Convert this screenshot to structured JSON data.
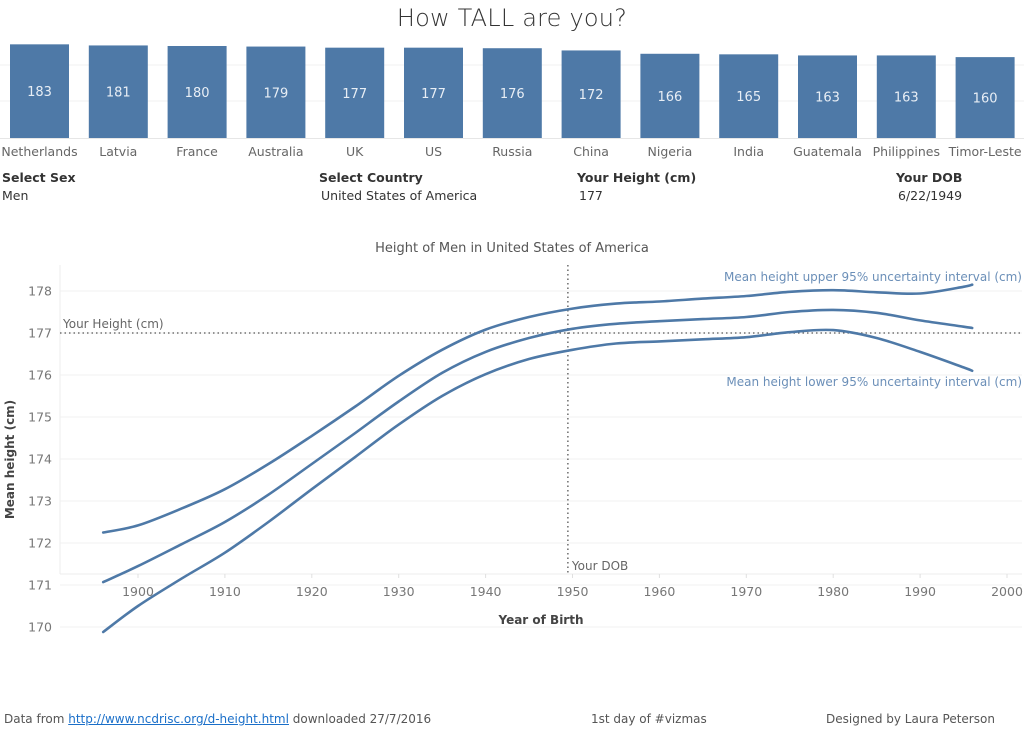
{
  "page": {
    "title": "How TALL are you?"
  },
  "filters": {
    "sex": {
      "label": "Select Sex",
      "value": "Men"
    },
    "country": {
      "label": "Select Country",
      "value": "United States of America"
    },
    "height": {
      "label": "Your Height (cm)",
      "value": "177"
    },
    "dob": {
      "label": "Your DOB",
      "value": "6/22/1949"
    }
  },
  "footer": {
    "prefix": "Data from ",
    "link_text": "http://www.ncdrisc.org/d-height.html",
    "suffix": " downloaded 27/7/2016",
    "center": "1st day of #vizmas",
    "right": "Designed by Laura Peterson"
  },
  "colors": {
    "bar": "#4e79a7",
    "line": "#4e79a7",
    "label_blue": "#6b8fb8",
    "grid": "#f0f0f0",
    "ref_line": "#555555"
  },
  "chart_data": [
    {
      "type": "bar",
      "title": "",
      "categories": [
        "Netherlands",
        "Latvia",
        "France",
        "Australia",
        "UK",
        "US",
        "Russia",
        "China",
        "Nigeria",
        "India",
        "Guatemala",
        "Philippines",
        "Timor-Leste"
      ],
      "values": [
        183,
        181,
        180,
        179,
        177,
        177,
        176,
        172,
        166,
        165,
        163,
        163,
        160
      ],
      "data_labels": [
        "183",
        "181",
        "180",
        "179",
        "177",
        "177",
        "176",
        "172",
        "166",
        "165",
        "163",
        "163",
        "160"
      ],
      "xlabel": "",
      "ylabel": "",
      "ylim": [
        0,
        185
      ],
      "grid": true
    },
    {
      "type": "line",
      "title": "Height of Men in United States of America",
      "xlabel": "Year of Birth",
      "ylabel": "Mean height (cm)",
      "xlim": [
        1891,
        2001
      ],
      "ylim": [
        169.45,
        178.55
      ],
      "xticks": [
        1900,
        1910,
        1920,
        1930,
        1940,
        1950,
        1960,
        1970,
        1980,
        1990,
        2000
      ],
      "yticks": [
        170,
        171,
        172,
        173,
        174,
        175,
        176,
        177,
        178
      ],
      "grid": true,
      "x": [
        1896,
        1900,
        1905,
        1910,
        1915,
        1920,
        1925,
        1930,
        1935,
        1940,
        1945,
        1950,
        1955,
        1960,
        1965,
        1970,
        1975,
        1980,
        1985,
        1990,
        1995,
        1996
      ],
      "series": [
        {
          "name": "Mean height upper 95% uncertainty interval (cm)",
          "values": [
            172.25,
            172.42,
            172.82,
            173.28,
            173.88,
            174.55,
            175.25,
            175.98,
            176.6,
            177.08,
            177.38,
            177.58,
            177.7,
            177.75,
            177.82,
            177.88,
            177.98,
            178.02,
            177.97,
            177.94,
            178.1,
            178.15
          ]
        },
        {
          "name": "Mean height (cm)",
          "values": [
            171.07,
            171.45,
            171.97,
            172.5,
            173.15,
            173.88,
            174.62,
            175.37,
            176.05,
            176.55,
            176.88,
            177.1,
            177.22,
            177.28,
            177.33,
            177.38,
            177.5,
            177.55,
            177.48,
            177.3,
            177.15,
            177.12
          ]
        },
        {
          "name": "Mean height lower 95% uncertainty interval (cm)",
          "values": [
            169.88,
            170.5,
            171.15,
            171.77,
            172.5,
            173.28,
            174.05,
            174.82,
            175.5,
            176.02,
            176.38,
            176.6,
            176.75,
            176.8,
            176.85,
            176.9,
            177.02,
            177.07,
            176.88,
            176.55,
            176.18,
            176.1
          ]
        }
      ],
      "series_labels": {
        "upper": "Mean height upper 95% uncertainty interval (cm)",
        "lower": "Mean height lower 95% uncertainty interval (cm)"
      },
      "reference_lines": [
        {
          "axis": "y",
          "value": 177,
          "label": "Your Height (cm)"
        },
        {
          "axis": "x",
          "value": 1949.47,
          "label": "Your DOB"
        }
      ]
    }
  ]
}
